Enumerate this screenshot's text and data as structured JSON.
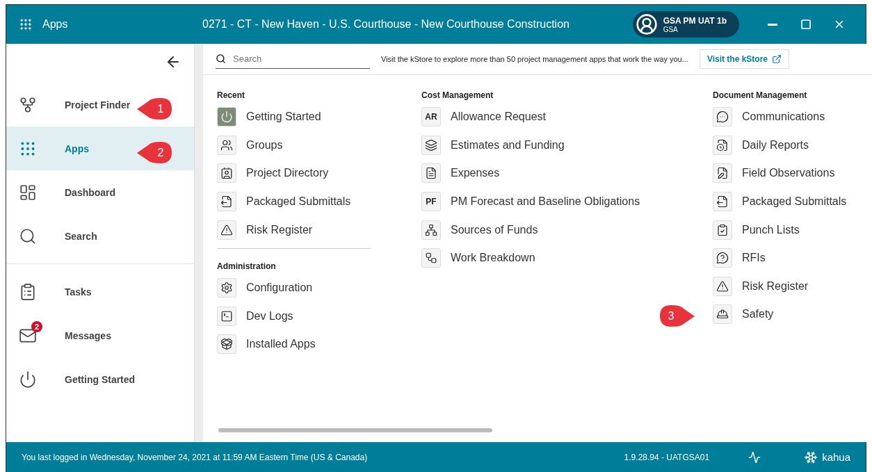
{
  "title_bar": {
    "app_title": "Apps",
    "project_title": "0271 - CT - New Haven - U.S. Courthouse - New Courthouse Construction",
    "user": {
      "name": "GSA PM UAT 1b",
      "org": "GSA"
    }
  },
  "sidebar": {
    "groups": [
      [
        {
          "label": "Project Finder",
          "selected": false
        },
        {
          "label": "Apps",
          "selected": true
        },
        {
          "label": "Dashboard",
          "selected": false
        },
        {
          "label": "Search",
          "selected": false
        }
      ],
      [
        {
          "label": "Tasks",
          "selected": false
        },
        {
          "label": "Messages",
          "selected": false,
          "badge": "2"
        },
        {
          "label": "Getting Started",
          "selected": false
        }
      ]
    ]
  },
  "toolbar": {
    "search": {
      "placeholder": "Search"
    },
    "kstore_text": "Visit the kStore to explore more than 50 project management apps that work the way you...",
    "kstore_button": "Visit the kStore"
  },
  "columns": [
    {
      "sections": [
        {
          "title": "Recent",
          "apps": [
            {
              "label": "Getting Started",
              "filled": true
            },
            {
              "label": "Groups",
              "filled": false
            },
            {
              "label": "Project Directory",
              "filled": false
            },
            {
              "label": "Packaged Submittals",
              "filled": false
            },
            {
              "label": "Risk Register",
              "filled": false
            }
          ]
        },
        {
          "title": "Administration",
          "apps": [
            {
              "label": "Configuration",
              "filled": false
            },
            {
              "label": "Dev Logs",
              "filled": false
            },
            {
              "label": "Installed Apps",
              "filled": false
            }
          ]
        }
      ]
    },
    {
      "sections": [
        {
          "title": "Cost Management",
          "apps": [
            {
              "label": "Allowance Request",
              "filled": false,
              "icon_text": "AR"
            },
            {
              "label": "Estimates and Funding",
              "filled": false
            },
            {
              "label": "Expenses",
              "filled": false
            },
            {
              "label": "PM Forecast and Baseline Obligations",
              "filled": false,
              "icon_text": "PF"
            },
            {
              "label": "Sources of Funds",
              "filled": false
            },
            {
              "label": "Work Breakdown",
              "filled": false
            }
          ]
        }
      ]
    },
    {
      "sections": [
        {
          "title": "Document Management",
          "apps": [
            {
              "label": "Communications",
              "filled": false
            },
            {
              "label": "Daily Reports",
              "filled": false
            },
            {
              "label": "Field Observations",
              "filled": false
            },
            {
              "label": "Packaged Submittals",
              "filled": false
            },
            {
              "label": "Punch Lists",
              "filled": false
            },
            {
              "label": "RFIs",
              "filled": false
            },
            {
              "label": "Risk Register",
              "filled": false
            },
            {
              "label": "Safety",
              "filled": false
            }
          ]
        }
      ]
    }
  ],
  "callouts": [
    "1",
    "2",
    "3"
  ],
  "status_bar": {
    "last_login": "You last logged in Wednesday, November 24, 2021 at 11:59 AM Eastern Time (US & Canada)",
    "version": "1.9.28.94 - UATGSA01",
    "brand": "kahua"
  }
}
